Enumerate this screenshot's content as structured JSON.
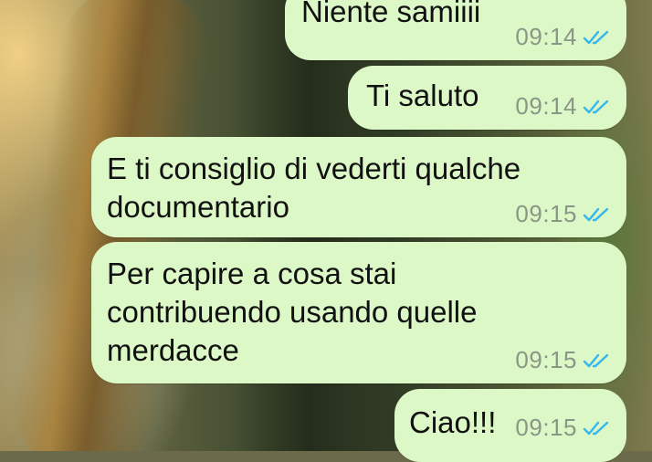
{
  "messages": [
    {
      "lines": [
        "Niente samiiii"
      ],
      "time": "09:14",
      "status_icon": "double-check-icon"
    },
    {
      "lines": [
        "Ti saluto"
      ],
      "time": "09:14",
      "status_icon": "double-check-icon"
    },
    {
      "lines": [
        "E ti consiglio di vederti qualche",
        "documentario"
      ],
      "time": "09:15",
      "status_icon": "double-check-icon"
    },
    {
      "lines": [
        "Per capire a cosa stai",
        "contribuendo usando quelle",
        "merdacce"
      ],
      "time": "09:15",
      "status_icon": "double-check-icon"
    },
    {
      "lines": [
        "Ciao!!!"
      ],
      "time": "09:15",
      "status_icon": "double-check-icon"
    }
  ],
  "colors": {
    "outgoing_bubble": "#dcf8c6",
    "time_text": "#8a9686",
    "read_ticks": "#34b7f1"
  }
}
